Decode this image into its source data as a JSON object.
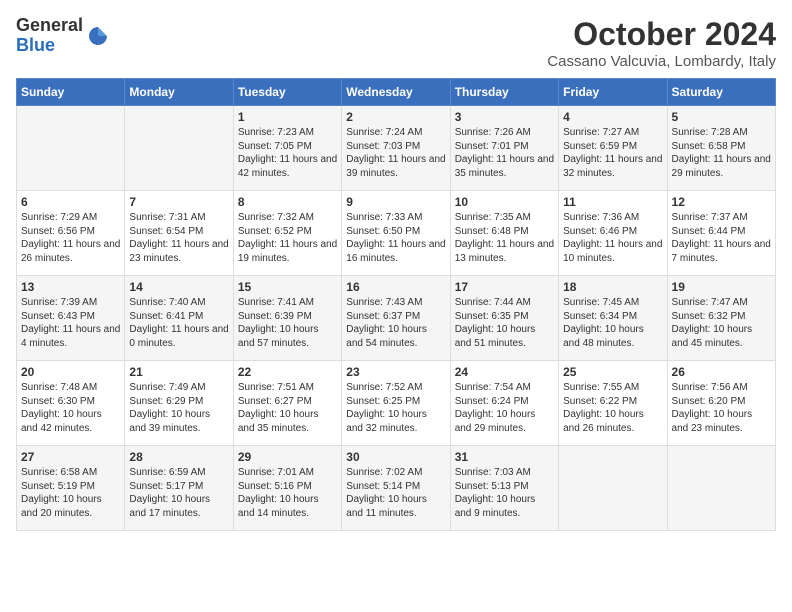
{
  "logo": {
    "general": "General",
    "blue": "Blue"
  },
  "header": {
    "month": "October 2024",
    "location": "Cassano Valcuvia, Lombardy, Italy"
  },
  "days_of_week": [
    "Sunday",
    "Monday",
    "Tuesday",
    "Wednesday",
    "Thursday",
    "Friday",
    "Saturday"
  ],
  "weeks": [
    [
      {
        "day": "",
        "content": ""
      },
      {
        "day": "",
        "content": ""
      },
      {
        "day": "1",
        "content": "Sunrise: 7:23 AM\nSunset: 7:05 PM\nDaylight: 11 hours and 42 minutes."
      },
      {
        "day": "2",
        "content": "Sunrise: 7:24 AM\nSunset: 7:03 PM\nDaylight: 11 hours and 39 minutes."
      },
      {
        "day": "3",
        "content": "Sunrise: 7:26 AM\nSunset: 7:01 PM\nDaylight: 11 hours and 35 minutes."
      },
      {
        "day": "4",
        "content": "Sunrise: 7:27 AM\nSunset: 6:59 PM\nDaylight: 11 hours and 32 minutes."
      },
      {
        "day": "5",
        "content": "Sunrise: 7:28 AM\nSunset: 6:58 PM\nDaylight: 11 hours and 29 minutes."
      }
    ],
    [
      {
        "day": "6",
        "content": "Sunrise: 7:29 AM\nSunset: 6:56 PM\nDaylight: 11 hours and 26 minutes."
      },
      {
        "day": "7",
        "content": "Sunrise: 7:31 AM\nSunset: 6:54 PM\nDaylight: 11 hours and 23 minutes."
      },
      {
        "day": "8",
        "content": "Sunrise: 7:32 AM\nSunset: 6:52 PM\nDaylight: 11 hours and 19 minutes."
      },
      {
        "day": "9",
        "content": "Sunrise: 7:33 AM\nSunset: 6:50 PM\nDaylight: 11 hours and 16 minutes."
      },
      {
        "day": "10",
        "content": "Sunrise: 7:35 AM\nSunset: 6:48 PM\nDaylight: 11 hours and 13 minutes."
      },
      {
        "day": "11",
        "content": "Sunrise: 7:36 AM\nSunset: 6:46 PM\nDaylight: 11 hours and 10 minutes."
      },
      {
        "day": "12",
        "content": "Sunrise: 7:37 AM\nSunset: 6:44 PM\nDaylight: 11 hours and 7 minutes."
      }
    ],
    [
      {
        "day": "13",
        "content": "Sunrise: 7:39 AM\nSunset: 6:43 PM\nDaylight: 11 hours and 4 minutes."
      },
      {
        "day": "14",
        "content": "Sunrise: 7:40 AM\nSunset: 6:41 PM\nDaylight: 11 hours and 0 minutes."
      },
      {
        "day": "15",
        "content": "Sunrise: 7:41 AM\nSunset: 6:39 PM\nDaylight: 10 hours and 57 minutes."
      },
      {
        "day": "16",
        "content": "Sunrise: 7:43 AM\nSunset: 6:37 PM\nDaylight: 10 hours and 54 minutes."
      },
      {
        "day": "17",
        "content": "Sunrise: 7:44 AM\nSunset: 6:35 PM\nDaylight: 10 hours and 51 minutes."
      },
      {
        "day": "18",
        "content": "Sunrise: 7:45 AM\nSunset: 6:34 PM\nDaylight: 10 hours and 48 minutes."
      },
      {
        "day": "19",
        "content": "Sunrise: 7:47 AM\nSunset: 6:32 PM\nDaylight: 10 hours and 45 minutes."
      }
    ],
    [
      {
        "day": "20",
        "content": "Sunrise: 7:48 AM\nSunset: 6:30 PM\nDaylight: 10 hours and 42 minutes."
      },
      {
        "day": "21",
        "content": "Sunrise: 7:49 AM\nSunset: 6:29 PM\nDaylight: 10 hours and 39 minutes."
      },
      {
        "day": "22",
        "content": "Sunrise: 7:51 AM\nSunset: 6:27 PM\nDaylight: 10 hours and 35 minutes."
      },
      {
        "day": "23",
        "content": "Sunrise: 7:52 AM\nSunset: 6:25 PM\nDaylight: 10 hours and 32 minutes."
      },
      {
        "day": "24",
        "content": "Sunrise: 7:54 AM\nSunset: 6:24 PM\nDaylight: 10 hours and 29 minutes."
      },
      {
        "day": "25",
        "content": "Sunrise: 7:55 AM\nSunset: 6:22 PM\nDaylight: 10 hours and 26 minutes."
      },
      {
        "day": "26",
        "content": "Sunrise: 7:56 AM\nSunset: 6:20 PM\nDaylight: 10 hours and 23 minutes."
      }
    ],
    [
      {
        "day": "27",
        "content": "Sunrise: 6:58 AM\nSunset: 5:19 PM\nDaylight: 10 hours and 20 minutes."
      },
      {
        "day": "28",
        "content": "Sunrise: 6:59 AM\nSunset: 5:17 PM\nDaylight: 10 hours and 17 minutes."
      },
      {
        "day": "29",
        "content": "Sunrise: 7:01 AM\nSunset: 5:16 PM\nDaylight: 10 hours and 14 minutes."
      },
      {
        "day": "30",
        "content": "Sunrise: 7:02 AM\nSunset: 5:14 PM\nDaylight: 10 hours and 11 minutes."
      },
      {
        "day": "31",
        "content": "Sunrise: 7:03 AM\nSunset: 5:13 PM\nDaylight: 10 hours and 9 minutes."
      },
      {
        "day": "",
        "content": ""
      },
      {
        "day": "",
        "content": ""
      }
    ]
  ]
}
